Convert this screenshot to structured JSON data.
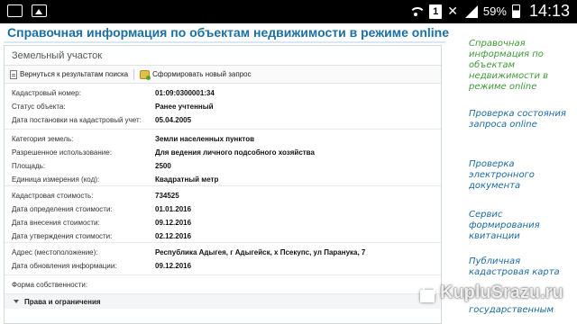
{
  "statusbar": {
    "battery": "59%",
    "time": "14:13",
    "badge": "1",
    "left_icons": [
      "mail-icon",
      "image-icon"
    ],
    "right_icons": [
      "wifi-icon",
      "sim-badge-icon",
      "no-signal-icon",
      "signal-icon",
      "battery-icon"
    ]
  },
  "page_title": "Справочная информация по объектам недвижимости в режиме online",
  "panel": {
    "header": "Земельный участок",
    "toolbar": {
      "back_label": "Вернуться к результатам поиска",
      "new_label": "Сформировать новый запрос"
    },
    "groups": [
      [
        {
          "key": "Кадастровый номер:",
          "value": "01:09:0300001:34"
        },
        {
          "key": "Статус объекта:",
          "value": "Ранее учтенный"
        },
        {
          "key": "Дата постановки на кадастровый учет:",
          "value": "05.04.2005"
        }
      ],
      [
        {
          "key": "Категория земель:",
          "value": "Земли населенных пунктов"
        },
        {
          "key": "Разрешенное использование:",
          "value": "Для ведения личного подсобного хозяйства"
        },
        {
          "key": "Площадь:",
          "value": "2500"
        },
        {
          "key": "Единица измерения (код):",
          "value": "Квадратный метр"
        }
      ],
      [
        {
          "key": "Кадастровая стоимость:",
          "value": "734525"
        },
        {
          "key": "Дата определения стоимости:",
          "value": "01.01.2016"
        },
        {
          "key": "Дата внесения стоимости:",
          "value": "09.12.2016"
        },
        {
          "key": "Дата утверждения стоимости:",
          "value": "02.12.2016"
        }
      ],
      [
        {
          "key": "Адрес (местоположение):",
          "value": "Республика Адыгея, г Адыгейск, х Псекупс, ул Паранука, 7"
        },
        {
          "key": "Дата обновления информации:",
          "value": "09.12.2016"
        }
      ],
      [
        {
          "key": "Форма собственности:",
          "value": ""
        }
      ]
    ],
    "rights_label": "Права и ограничения"
  },
  "sidebar": {
    "links": [
      "Справочная информация по объектам недвижимости в режиме online",
      "Проверка состояния запроса online",
      "Проверка электронного документа",
      "Сервис формирования квитанции",
      "Публичная кадастровая карта",
      "государственным"
    ]
  },
  "watermark": "KupluSrazu.ru",
  "colors": {
    "title": "#1a6fa3",
    "link": "#1b6aa0",
    "active_link": "#3f9a3a"
  }
}
